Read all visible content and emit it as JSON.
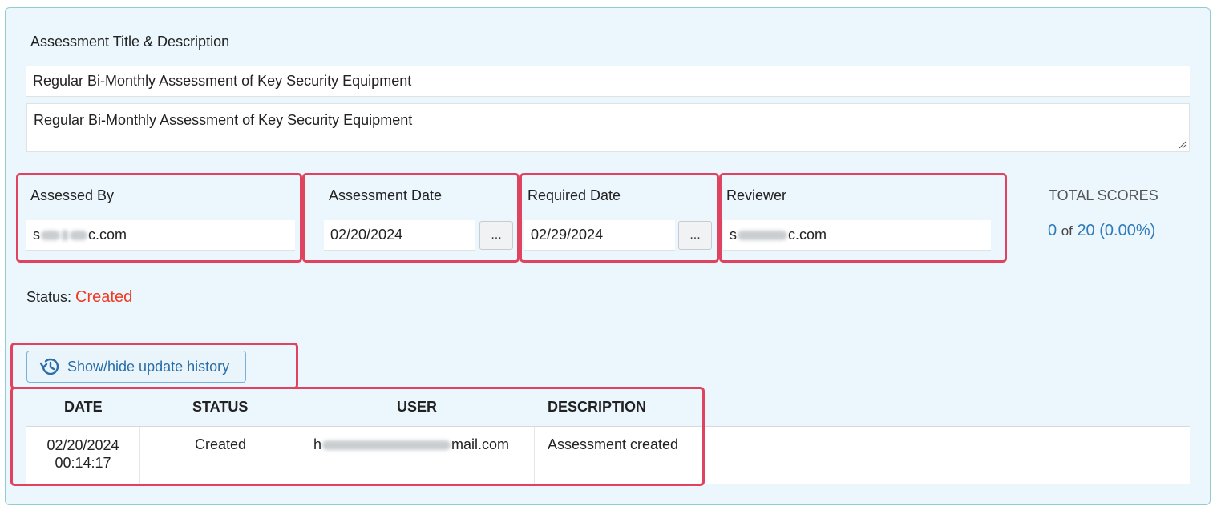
{
  "section": {
    "title": "Assessment Title & Description",
    "title_value": "Regular Bi-Monthly Assessment of Key Security Equipment",
    "description_value": "Regular Bi-Monthly Assessment of Key Security Equipment"
  },
  "fields": {
    "assessed_by_label": "Assessed By",
    "assessed_by_prefix": "s",
    "assessed_by_suffix": "c.com",
    "assessment_date_label": "Assessment Date",
    "assessment_date_value": "02/20/2024",
    "required_date_label": "Required Date",
    "required_date_value": "02/29/2024",
    "reviewer_label": "Reviewer",
    "reviewer_prefix": "s",
    "reviewer_suffix": "c.com",
    "picker_label": "..."
  },
  "scores": {
    "title": "TOTAL SCORES",
    "current": "0",
    "of_label": "of",
    "total": "20",
    "percent": "(0.00%)"
  },
  "status": {
    "label": "Status:",
    "value": "Created"
  },
  "history": {
    "button_label": "Show/hide update history",
    "columns": [
      "DATE",
      "STATUS",
      "USER",
      "DESCRIPTION"
    ],
    "rows": [
      {
        "date": "02/20/2024",
        "time": "00:14:17",
        "status": "Created",
        "user_prefix": "h",
        "user_suffix": "mail.com",
        "description": "Assessment created"
      }
    ]
  },
  "icons": {
    "history": "history-icon",
    "resize": "resize-grip-icon"
  },
  "colors": {
    "panel_bg": "#ebf6fd",
    "highlight": "#e0435f",
    "status_created": "#ee3a23",
    "score_blue": "#2f7ab8",
    "button_text": "#2a6ea8"
  }
}
